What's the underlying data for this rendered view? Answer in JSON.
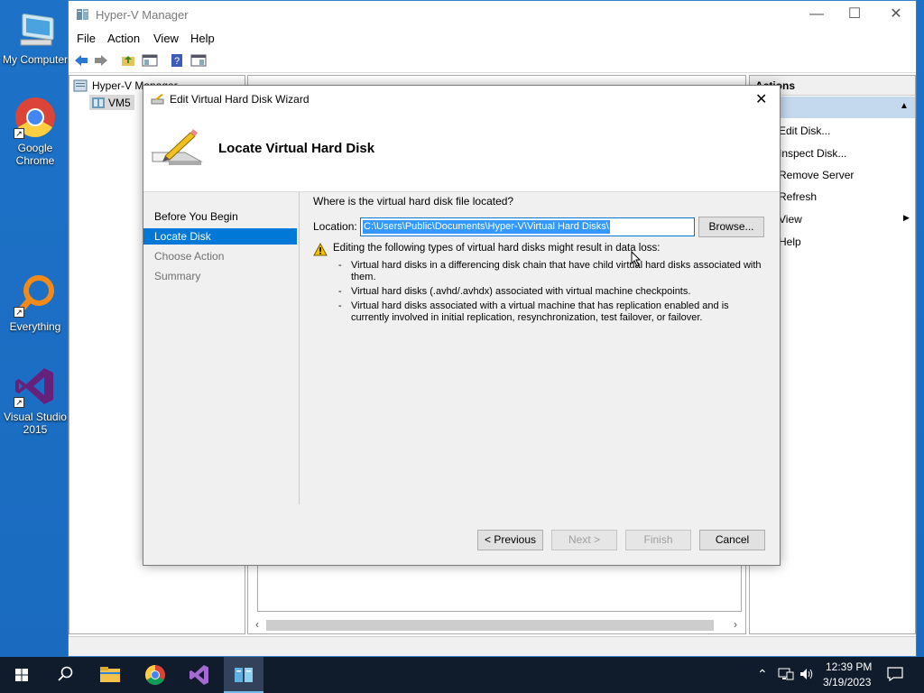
{
  "desktop": {
    "icons": [
      {
        "label": "My Computer",
        "icon": "computer-icon"
      },
      {
        "label": "Google Chrome",
        "icon": "chrome-icon"
      },
      {
        "label": "Everything",
        "icon": "everything-search-icon"
      },
      {
        "label": "Visual Studio 2015",
        "icon": "visual-studio-icon"
      }
    ]
  },
  "hyperv": {
    "title": "Hyper-V Manager",
    "menu": [
      "File",
      "Action",
      "View",
      "Help"
    ],
    "tree": {
      "root": "Hyper-V Manager",
      "server": "VM5"
    },
    "actions": {
      "header": "Actions",
      "items": [
        "Edit Disk...",
        "Inspect Disk...",
        "Remove Server",
        "Refresh",
        "View",
        "Help"
      ]
    }
  },
  "wizard": {
    "title": "Edit Virtual Hard Disk Wizard",
    "heading": "Locate Virtual Hard Disk",
    "steps": [
      "Before You Begin",
      "Locate Disk",
      "Choose Action",
      "Summary"
    ],
    "active_step": "Locate Disk",
    "question": "Where is the virtual hard disk file located?",
    "location_label": "Location:",
    "location_value": "C:\\Users\\Public\\Documents\\Hyper-V\\Virtual Hard Disks\\",
    "browse_label": "Browse...",
    "warning": "Editing the following types of virtual hard disks might result in data loss:",
    "bullets": [
      "Virtual hard disks in a differencing disk chain that have child virtual hard disks associated with them.",
      "Virtual hard disks (.avhd/.avhdx) associated with virtual machine checkpoints.",
      "Virtual hard disks associated with a virtual machine that has replication enabled and is currently involved in initial replication, resynchronization, test failover, or failover."
    ],
    "buttons": {
      "previous": "< Previous",
      "next": "Next >",
      "finish": "Finish",
      "cancel": "Cancel"
    }
  },
  "taskbar": {
    "time": "12:39 PM",
    "date": "3/19/2023",
    "pinned": [
      "file-explorer-icon",
      "chrome-icon",
      "visual-studio-icon",
      "hyperv-manager-icon"
    ]
  },
  "colors": {
    "accent": "#0078d7",
    "selection": "#3399ff",
    "desktop": "#1d72c7"
  }
}
